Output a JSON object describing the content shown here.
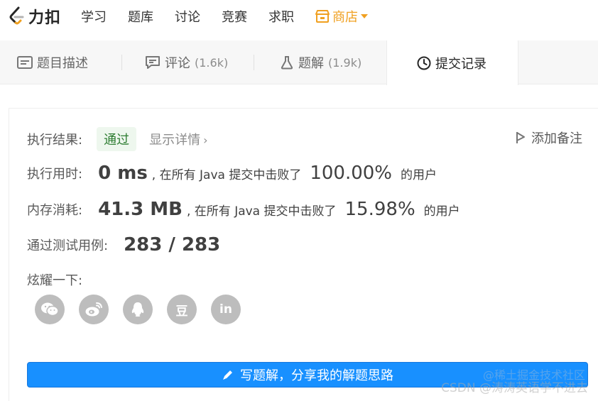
{
  "nav": {
    "logo_text": "力扣",
    "items": [
      "学习",
      "题库",
      "讨论",
      "竞赛",
      "求职"
    ],
    "store_label": "商店",
    "accent_color": "#f0a020"
  },
  "tabs": {
    "description": {
      "label": "题目描述",
      "icon": "doc-icon"
    },
    "comments": {
      "label": "评论",
      "count": "(1.6k)",
      "icon": "comment-icon"
    },
    "solutions": {
      "label": "题解",
      "count": "(1.9k)",
      "icon": "flask-icon"
    },
    "submissions": {
      "label": "提交记录",
      "icon": "clock-icon"
    }
  },
  "result": {
    "status_label": "执行结果:",
    "status_value": "通过",
    "detail_link": "显示详情",
    "add_note": "添加备注",
    "runtime_label": "执行用时:",
    "runtime_value": "0 ms",
    "runtime_mid": ", 在所有 Java 提交中击败了",
    "runtime_pct": "100.00%",
    "runtime_tail": "的用户",
    "memory_label": "内存消耗:",
    "memory_value": "41.3 MB",
    "memory_mid": ", 在所有 Java 提交中击败了",
    "memory_pct": "15.98%",
    "memory_tail": "的用户",
    "tests_label": "通过测试用例:",
    "tests_value": "283 / 283",
    "share_label": "炫耀一下:"
  },
  "share_icons": [
    "wechat-icon",
    "weibo-icon",
    "qq-icon",
    "douban-icon",
    "linkedin-icon"
  ],
  "share_glyphs": {
    "douban": "豆",
    "linkedin": "in"
  },
  "write_button": "写题解，分享我的解题思路",
  "watermark": {
    "line1": "@稀土掘金技术社区",
    "line2": "CSDN @涛涛英语学不进去"
  },
  "colors": {
    "primary": "#1890ff",
    "pass_green": "#2e7d32"
  }
}
